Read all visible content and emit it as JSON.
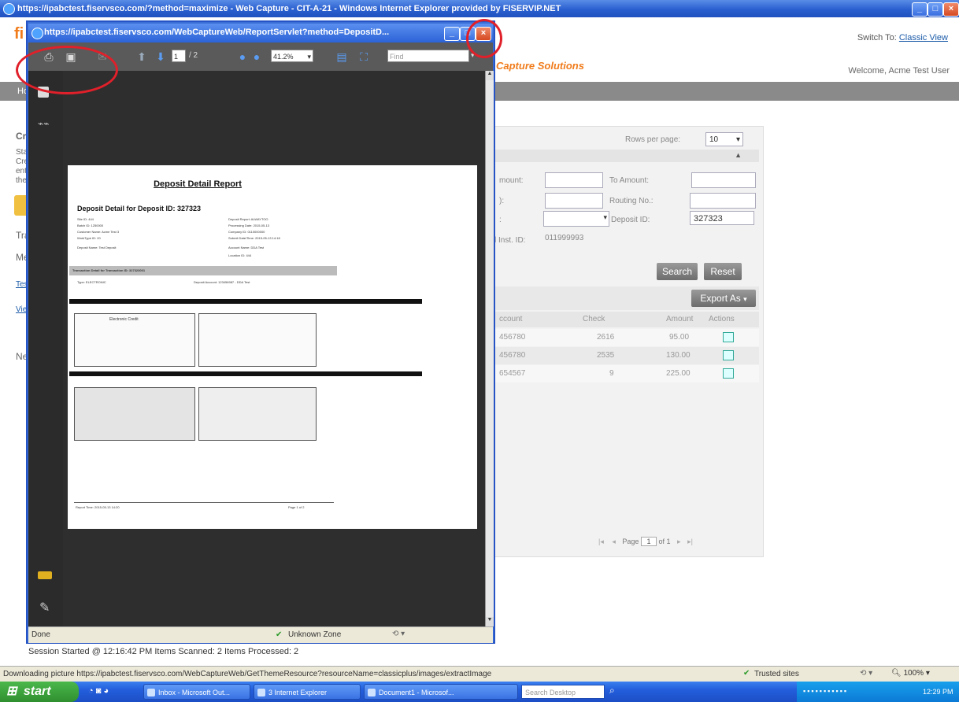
{
  "outer_window": {
    "title": "https://ipabctest.fiservsco.com/?method=maximize - Web Capture - CIT-A-21 - Windows Internet Explorer provided by FISERVIP.NET",
    "buttons": [
      "_",
      "□",
      "X"
    ]
  },
  "app": {
    "logo_fragment": "fi",
    "brand_tagline": "Capture Solutions",
    "switch_to_label": "Switch To:",
    "switch_to_link": "Classic View",
    "welcome": "Welcome, Acme Test User",
    "nav_home": "Ho",
    "left_fragments": {
      "cr": "Cr",
      "sta": "Sta",
      "cre": "Cre",
      "ent": "ent",
      "the": "the",
      "tra": "Tra",
      "me": "Me",
      "tes": "Tes",
      "vie": "Vie",
      "ne": "Ne"
    },
    "search": {
      "rows_per_page_label": "Rows per page:",
      "rows_per_page_value": "10",
      "from_amount_label": "mount:",
      "to_amount_label": "To Amount:",
      "routing_label_left": "):",
      "routing_label": "Routing No.:",
      "deposit_id_label": "Deposit ID:",
      "deposit_id_value": "327323",
      "type_label": ":",
      "inst_id_label": "l Inst. ID:",
      "inst_id_value": "011999993",
      "search_button": "Search",
      "reset_button": "Reset"
    },
    "results": {
      "export_button": "Export As",
      "headers": [
        "ccount",
        "Check",
        "Amount",
        "Actions"
      ],
      "rows": [
        [
          "456780",
          "2616",
          "95.00"
        ],
        [
          "456780",
          "2535",
          "130.00"
        ],
        [
          "654567",
          "9",
          "225.00"
        ]
      ],
      "pager": {
        "page_label": "Page",
        "page_value": "1",
        "of_label": "of 1"
      }
    },
    "session_bar": "Session Started @ 12:16:42 PM  Items Scanned: 2  Items Processed: 2"
  },
  "popup": {
    "title": "https://ipabctest.fiservsco.com/WebCaptureWeb/ReportServlet?method=DepositD...",
    "toolbar": {
      "page_current": "1",
      "page_total": "/ 2",
      "zoom": "41.2%",
      "find_placeholder": "Find"
    },
    "status_left": "Done",
    "status_zone": "Unknown Zone",
    "report": {
      "title": "Deposit Detail Report",
      "subtitle": "Deposit Detail for Deposit ID: 327323",
      "left_fields": [
        "Site ID: 444",
        "Batch ID: 1250000",
        "Customer Name: Acme Test 3",
        "WorkType ID: 20",
        "Deposit Name: Test Deposit"
      ],
      "right_fields": [
        "Deposit Report: ALWAYTOO",
        "Processing Date:  2015-05-13",
        "Company ID: 0110000000",
        "Submit Date/Time: 2015-05-13 14:18",
        "Account Name: DDA Test",
        "Location ID: 444"
      ],
      "transaction_banner": "Transaction Detail for Transaction ID: 327323001",
      "type_line": "Type: ELECTRONIC",
      "deposit_account_line": "Deposit Account: 123456987 - DDA Test",
      "check_header": "Electronic Credit",
      "footer_left": "Report Time: 2015-05-13 14:20",
      "footer_right": "Page 1 of 2"
    }
  },
  "status_bar": {
    "download": "Downloading picture https://ipabctest.fiservsco.com/WebCaptureWeb/GetThemeResource?resourceName=classicplus/images/extractImage",
    "trusted": "Trusted sites",
    "zoom": "100%"
  },
  "taskbar": {
    "start": "start",
    "tasks": [
      "Inbox - Microsoft Out...",
      "3 Internet Explorer",
      "Document1 - Microsof..."
    ],
    "search_placeholder": "Search Desktop",
    "clock": "12:29 PM"
  },
  "colors": {
    "accent_orange": "#f07c1c",
    "ie_blue": "#2b62d6",
    "annotation_red": "#e0202a"
  }
}
